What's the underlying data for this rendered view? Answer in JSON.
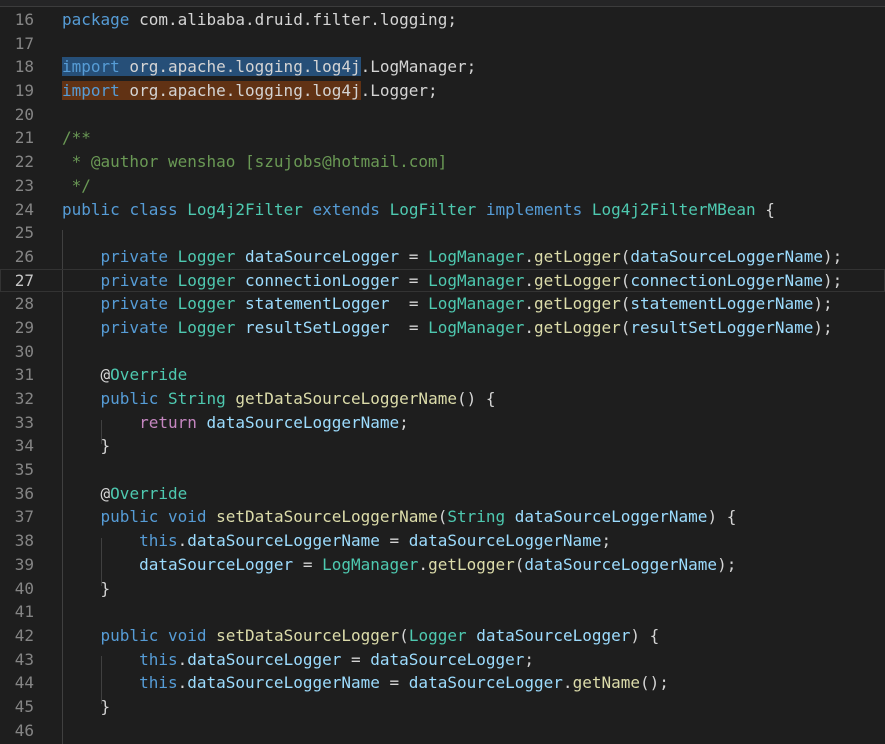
{
  "editor": {
    "language": "java",
    "colors": {
      "background": "#1e1e1e",
      "line_number": "#858585",
      "keyword": "#569cd6",
      "control_keyword": "#c586c0",
      "type": "#4ec9b0",
      "function": "#dcdcaa",
      "variable": "#9cdcfe",
      "comment": "#6a9955",
      "plain": "#d4d4d4",
      "selection_highlight": "#264f78",
      "find_highlight": "#613214"
    },
    "current_line": 27,
    "lines": [
      {
        "num": "16",
        "tokens": [
          [
            "kw",
            "package"
          ],
          [
            "pl",
            " com.alibaba.druid.filter.logging;"
          ]
        ]
      },
      {
        "num": "17",
        "tokens": []
      },
      {
        "num": "18",
        "tokens": [
          [
            "kw hl-blue",
            "import"
          ],
          [
            "pl hl-blue",
            " org.apache.logging.log4j"
          ],
          [
            "pl",
            ".LogManager;"
          ]
        ]
      },
      {
        "num": "19",
        "tokens": [
          [
            "kw hl-orange",
            "import"
          ],
          [
            "pl hl-orange",
            " org.apache.logging.log4j"
          ],
          [
            "pl",
            ".Logger;"
          ]
        ]
      },
      {
        "num": "20",
        "tokens": []
      },
      {
        "num": "21",
        "tokens": [
          [
            "cm",
            "/**"
          ]
        ]
      },
      {
        "num": "22",
        "tokens": [
          [
            "cm",
            " * @author wenshao [szujobs@hotmail.com]"
          ]
        ]
      },
      {
        "num": "23",
        "tokens": [
          [
            "cm",
            " */"
          ]
        ]
      },
      {
        "num": "24",
        "tokens": [
          [
            "kw",
            "public"
          ],
          [
            "pl",
            " "
          ],
          [
            "kw",
            "class"
          ],
          [
            "pl",
            " "
          ],
          [
            "ty",
            "Log4j2Filter"
          ],
          [
            "pl",
            " "
          ],
          [
            "kw",
            "extends"
          ],
          [
            "pl",
            " "
          ],
          [
            "ty",
            "LogFilter"
          ],
          [
            "pl",
            " "
          ],
          [
            "kw",
            "implements"
          ],
          [
            "pl",
            " "
          ],
          [
            "ty",
            "Log4j2FilterMBean"
          ],
          [
            "pl",
            " {"
          ]
        ]
      },
      {
        "num": "25",
        "tokens": []
      },
      {
        "num": "26",
        "tokens": [
          [
            "pl",
            "    "
          ],
          [
            "kw",
            "private"
          ],
          [
            "pl",
            " "
          ],
          [
            "ty",
            "Logger"
          ],
          [
            "pl",
            " "
          ],
          [
            "var",
            "dataSourceLogger"
          ],
          [
            "pl",
            " = "
          ],
          [
            "ty",
            "LogManager"
          ],
          [
            "pl",
            "."
          ],
          [
            "fn",
            "getLogger"
          ],
          [
            "pl",
            "("
          ],
          [
            "var",
            "dataSourceLoggerName"
          ],
          [
            "pl",
            ");"
          ]
        ]
      },
      {
        "num": "27",
        "tokens": [
          [
            "pl",
            "    "
          ],
          [
            "kw",
            "private"
          ],
          [
            "pl",
            " "
          ],
          [
            "ty",
            "Logger"
          ],
          [
            "pl",
            " "
          ],
          [
            "var",
            "connectionLogger"
          ],
          [
            "pl",
            " = "
          ],
          [
            "ty",
            "LogManager"
          ],
          [
            "pl",
            "."
          ],
          [
            "fn",
            "getLogger"
          ],
          [
            "pl",
            "("
          ],
          [
            "var",
            "connectionLoggerName"
          ],
          [
            "pl",
            ");"
          ]
        ]
      },
      {
        "num": "28",
        "tokens": [
          [
            "pl",
            "    "
          ],
          [
            "kw",
            "private"
          ],
          [
            "pl",
            " "
          ],
          [
            "ty",
            "Logger"
          ],
          [
            "pl",
            " "
          ],
          [
            "var",
            "statementLogger"
          ],
          [
            "pl",
            "  = "
          ],
          [
            "ty",
            "LogManager"
          ],
          [
            "pl",
            "."
          ],
          [
            "fn",
            "getLogger"
          ],
          [
            "pl",
            "("
          ],
          [
            "var",
            "statementLoggerName"
          ],
          [
            "pl",
            ");"
          ]
        ]
      },
      {
        "num": "29",
        "tokens": [
          [
            "pl",
            "    "
          ],
          [
            "kw",
            "private"
          ],
          [
            "pl",
            " "
          ],
          [
            "ty",
            "Logger"
          ],
          [
            "pl",
            " "
          ],
          [
            "var",
            "resultSetLogger"
          ],
          [
            "pl",
            "  = "
          ],
          [
            "ty",
            "LogManager"
          ],
          [
            "pl",
            "."
          ],
          [
            "fn",
            "getLogger"
          ],
          [
            "pl",
            "("
          ],
          [
            "var",
            "resultSetLoggerName"
          ],
          [
            "pl",
            ");"
          ]
        ]
      },
      {
        "num": "30",
        "tokens": []
      },
      {
        "num": "31",
        "tokens": [
          [
            "pl",
            "    @"
          ],
          [
            "an",
            "Override"
          ]
        ]
      },
      {
        "num": "32",
        "tokens": [
          [
            "pl",
            "    "
          ],
          [
            "kw",
            "public"
          ],
          [
            "pl",
            " "
          ],
          [
            "ty",
            "String"
          ],
          [
            "pl",
            " "
          ],
          [
            "fn",
            "getDataSourceLoggerName"
          ],
          [
            "pl",
            "() {"
          ]
        ]
      },
      {
        "num": "33",
        "tokens": [
          [
            "pl",
            "        "
          ],
          [
            "kw2",
            "return"
          ],
          [
            "pl",
            " "
          ],
          [
            "var",
            "dataSourceLoggerName"
          ],
          [
            "pl",
            ";"
          ]
        ]
      },
      {
        "num": "34",
        "tokens": [
          [
            "pl",
            "    }"
          ]
        ]
      },
      {
        "num": "35",
        "tokens": []
      },
      {
        "num": "36",
        "tokens": [
          [
            "pl",
            "    @"
          ],
          [
            "an",
            "Override"
          ]
        ]
      },
      {
        "num": "37",
        "tokens": [
          [
            "pl",
            "    "
          ],
          [
            "kw",
            "public"
          ],
          [
            "pl",
            " "
          ],
          [
            "kw",
            "void"
          ],
          [
            "pl",
            " "
          ],
          [
            "fn",
            "setDataSourceLoggerName"
          ],
          [
            "pl",
            "("
          ],
          [
            "ty",
            "String"
          ],
          [
            "pl",
            " "
          ],
          [
            "var",
            "dataSourceLoggerName"
          ],
          [
            "pl",
            ") {"
          ]
        ]
      },
      {
        "num": "38",
        "tokens": [
          [
            "pl",
            "        "
          ],
          [
            "kw",
            "this"
          ],
          [
            "pl",
            "."
          ],
          [
            "var",
            "dataSourceLoggerName"
          ],
          [
            "pl",
            " = "
          ],
          [
            "var",
            "dataSourceLoggerName"
          ],
          [
            "pl",
            ";"
          ]
        ]
      },
      {
        "num": "39",
        "tokens": [
          [
            "pl",
            "        "
          ],
          [
            "var",
            "dataSourceLogger"
          ],
          [
            "pl",
            " = "
          ],
          [
            "ty",
            "LogManager"
          ],
          [
            "pl",
            "."
          ],
          [
            "fn",
            "getLogger"
          ],
          [
            "pl",
            "("
          ],
          [
            "var",
            "dataSourceLoggerName"
          ],
          [
            "pl",
            ");"
          ]
        ]
      },
      {
        "num": "40",
        "tokens": [
          [
            "pl",
            "    }"
          ]
        ]
      },
      {
        "num": "41",
        "tokens": []
      },
      {
        "num": "42",
        "tokens": [
          [
            "pl",
            "    "
          ],
          [
            "kw",
            "public"
          ],
          [
            "pl",
            " "
          ],
          [
            "kw",
            "void"
          ],
          [
            "pl",
            " "
          ],
          [
            "fn",
            "setDataSourceLogger"
          ],
          [
            "pl",
            "("
          ],
          [
            "ty",
            "Logger"
          ],
          [
            "pl",
            " "
          ],
          [
            "var",
            "dataSourceLogger"
          ],
          [
            "pl",
            ") {"
          ]
        ]
      },
      {
        "num": "43",
        "tokens": [
          [
            "pl",
            "        "
          ],
          [
            "kw",
            "this"
          ],
          [
            "pl",
            "."
          ],
          [
            "var",
            "dataSourceLogger"
          ],
          [
            "pl",
            " = "
          ],
          [
            "var",
            "dataSourceLogger"
          ],
          [
            "pl",
            ";"
          ]
        ]
      },
      {
        "num": "44",
        "tokens": [
          [
            "pl",
            "        "
          ],
          [
            "kw",
            "this"
          ],
          [
            "pl",
            "."
          ],
          [
            "var",
            "dataSourceLoggerName"
          ],
          [
            "pl",
            " = "
          ],
          [
            "var",
            "dataSourceLogger"
          ],
          [
            "pl",
            "."
          ],
          [
            "fn",
            "getName"
          ],
          [
            "pl",
            "();"
          ]
        ]
      },
      {
        "num": "45",
        "tokens": [
          [
            "pl",
            "    }"
          ]
        ]
      },
      {
        "num": "46",
        "tokens": []
      }
    ]
  }
}
